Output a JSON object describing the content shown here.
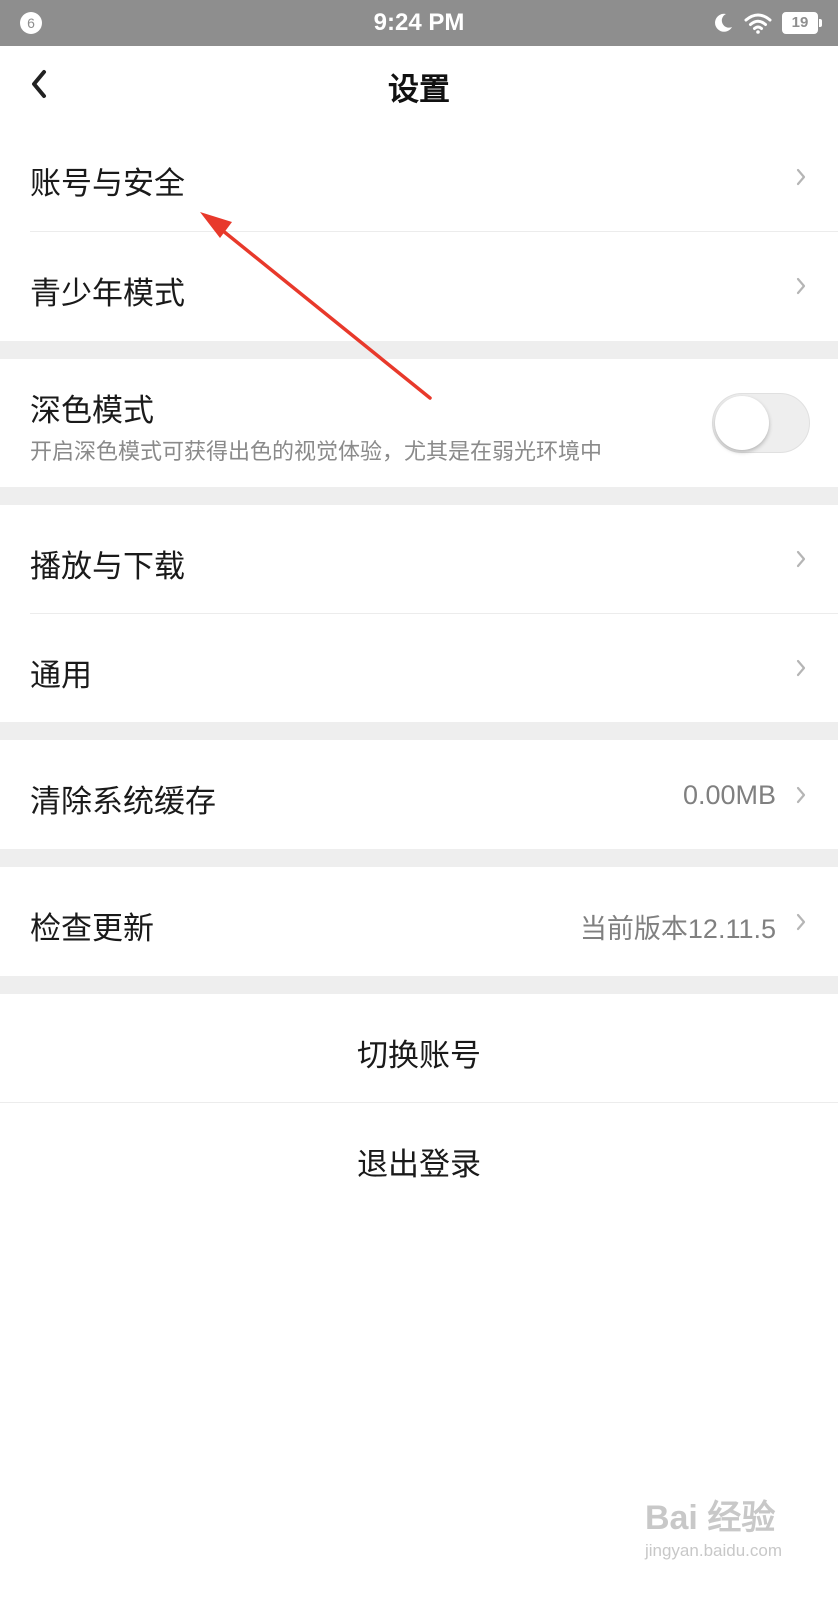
{
  "status_bar": {
    "notification_count": "6",
    "time": "9:24 PM",
    "battery_level": "19",
    "icons": [
      "moon-icon",
      "wifi-icon",
      "battery-icon"
    ]
  },
  "header": {
    "title": "设置",
    "back_icon": "chevron-left-icon"
  },
  "menu": {
    "account_security": "账号与安全",
    "teen_mode": "青少年模式",
    "dark_mode": {
      "label": "深色模式",
      "description": "开启深色模式可获得出色的视觉体验，尤其是在弱光环境中",
      "enabled": false
    },
    "play_download": "播放与下载",
    "general": "通用",
    "clear_cache": {
      "label": "清除系统缓存",
      "value": "0.00MB"
    },
    "check_update": {
      "label": "检查更新",
      "value": "当前版本12.11.5"
    }
  },
  "actions": {
    "switch_account": "切换账号",
    "logout": "退出登录"
  },
  "annotation": {
    "arrow_color": "#e8392b"
  },
  "watermark": {
    "logo": "Bai 经验",
    "url": "jingyan.baidu.com"
  },
  "colors": {
    "status_bar_bg": "#8e8e8e",
    "section_gap": "#eeeeee",
    "secondary_text": "#808080"
  }
}
